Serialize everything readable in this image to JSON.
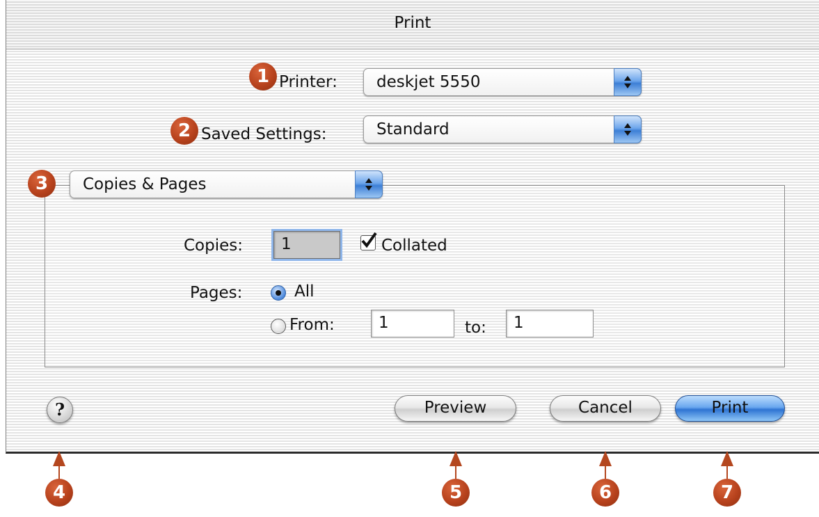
{
  "window": {
    "title": "Print"
  },
  "printer": {
    "label": "Printer:",
    "value": "deskjet 5550",
    "callout": "1"
  },
  "saved_settings": {
    "label": "Saved Settings:",
    "value": "Standard",
    "callout": "2"
  },
  "panel_menu": {
    "value": "Copies & Pages",
    "callout": "3"
  },
  "copies": {
    "label": "Copies:",
    "value": "1",
    "collated_label": "Collated",
    "collated_checked": true
  },
  "pages": {
    "label": "Pages:",
    "all_label": "All",
    "all_selected": true,
    "from_label": "From:",
    "from_value": "1",
    "to_label": "to:",
    "to_value": "1"
  },
  "buttons": {
    "help": "?",
    "preview": "Preview",
    "cancel": "Cancel",
    "print": "Print"
  },
  "callouts": {
    "help": "4",
    "preview": "5",
    "cancel": "6",
    "print": "7"
  },
  "colors": {
    "callout": "#b4471f",
    "default_button": "#3d7fd6",
    "stripe": "#e4e4e4"
  },
  "icons": {
    "popup_arrows": "up-down-arrows-icon",
    "checkbox": "checkmark-icon",
    "help": "question-mark-icon"
  }
}
